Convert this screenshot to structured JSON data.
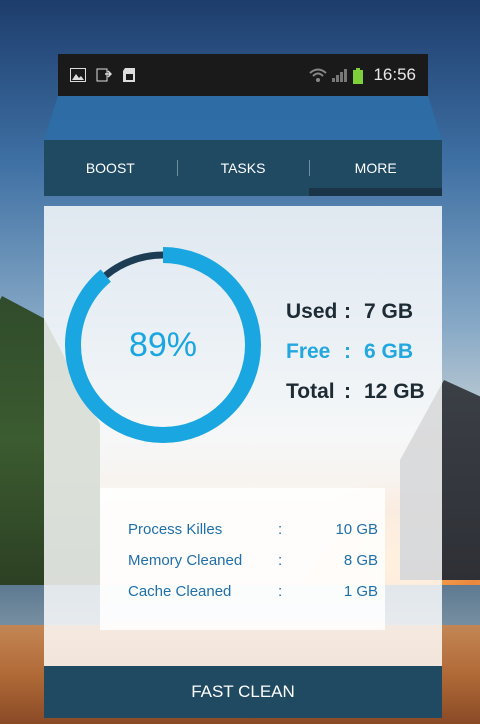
{
  "status_bar": {
    "time": "16:56",
    "icons_left": [
      "image-icon",
      "download-icon",
      "sd-card-icon"
    ],
    "icons_right": [
      "wifi-icon",
      "signal-icon",
      "battery-icon"
    ]
  },
  "tabs": [
    {
      "label": "BOOST"
    },
    {
      "label": "TASKS"
    },
    {
      "label": "MORE"
    }
  ],
  "gauge": {
    "percent_text": "89%",
    "percent": 89,
    "arc_color": "#1aa6e0",
    "track_color": "#1d3d55"
  },
  "memory": {
    "used": {
      "label": "Used",
      "sep": ":",
      "value": "7 GB"
    },
    "free": {
      "label": "Free",
      "sep": ":",
      "value": "6 GB"
    },
    "total": {
      "label": "Total",
      "sep": ":",
      "value": "12 GB"
    }
  },
  "details": [
    {
      "label": "Process Killes",
      "sep": ":",
      "value": "10 GB"
    },
    {
      "label": "Memory Cleaned",
      "sep": ":",
      "value": "8 GB"
    },
    {
      "label": "Cache Cleaned",
      "sep": ":",
      "value": "1 GB"
    }
  ],
  "action": {
    "label": "FAST CLEAN"
  },
  "colors": {
    "tab_bar": "#1f4a62",
    "accent": "#23a7df",
    "dark_text": "#1d2b35"
  }
}
